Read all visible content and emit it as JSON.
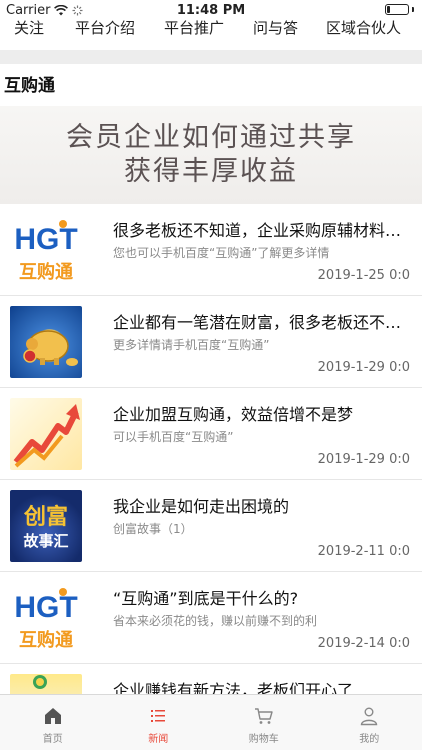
{
  "status": {
    "carrier": "Carrier",
    "time": "11:48 PM",
    "battery_level": 0.15
  },
  "top_tabs": [
    {
      "label": "关注",
      "active": true
    },
    {
      "label": "平台介绍",
      "active": false
    },
    {
      "label": "平台推广",
      "active": false
    },
    {
      "label": "问与答",
      "active": false
    },
    {
      "label": "区域合伙人",
      "active": false
    }
  ],
  "section_title": "互购通",
  "banner": {
    "line1": "会员企业如何通过共享",
    "line2": "获得丰厚收益"
  },
  "thumbnail_text": {
    "hgt_logo": "HGT",
    "hgt_name": "互购通",
    "story_line1": "创富",
    "story_line2": "故事汇"
  },
  "news": [
    {
      "title": "很多老板还不知道，企业采购原辅材料也可以赚钱",
      "subtitle": "您也可以手机百度“互购通”了解更多详情",
      "date": "2019-1-25 0:0",
      "thumb": "hgt"
    },
    {
      "title": "企业都有一笔潜在财富，很多老板还不知道",
      "subtitle": "更多详情请手机百度“互购通”",
      "date": "2019-1-29 0:0",
      "thumb": "pig"
    },
    {
      "title": "企业加盟互购通，效益倍增不是梦",
      "subtitle": "可以手机百度“互购通”",
      "date": "2019-1-29 0:0",
      "thumb": "arrow"
    },
    {
      "title": "我企业是如何走出困境的",
      "subtitle": "创富故事（1）",
      "date": "2019-2-11 0:0",
      "thumb": "story"
    },
    {
      "title": "“互购通”到底是干什么的?",
      "subtitle": "省本来必须花的钱，赚以前赚不到的利",
      "date": "2019-2-14 0:0",
      "thumb": "hgt"
    },
    {
      "title": "企业赚钱有新方法，老板们开心了",
      "subtitle": "",
      "date": "",
      "thumb": "cut"
    }
  ],
  "bottom_tabs": [
    {
      "label": "首页",
      "icon": "home-icon",
      "active": false
    },
    {
      "label": "新闻",
      "icon": "list-icon",
      "active": true
    },
    {
      "label": "购物车",
      "icon": "cart-icon",
      "active": false
    },
    {
      "label": "我的",
      "icon": "user-icon",
      "active": false
    }
  ],
  "colors": {
    "accent": "#e8493a",
    "hgt_blue": "#1c5fc1",
    "hgt_orange": "#f29a1f"
  }
}
